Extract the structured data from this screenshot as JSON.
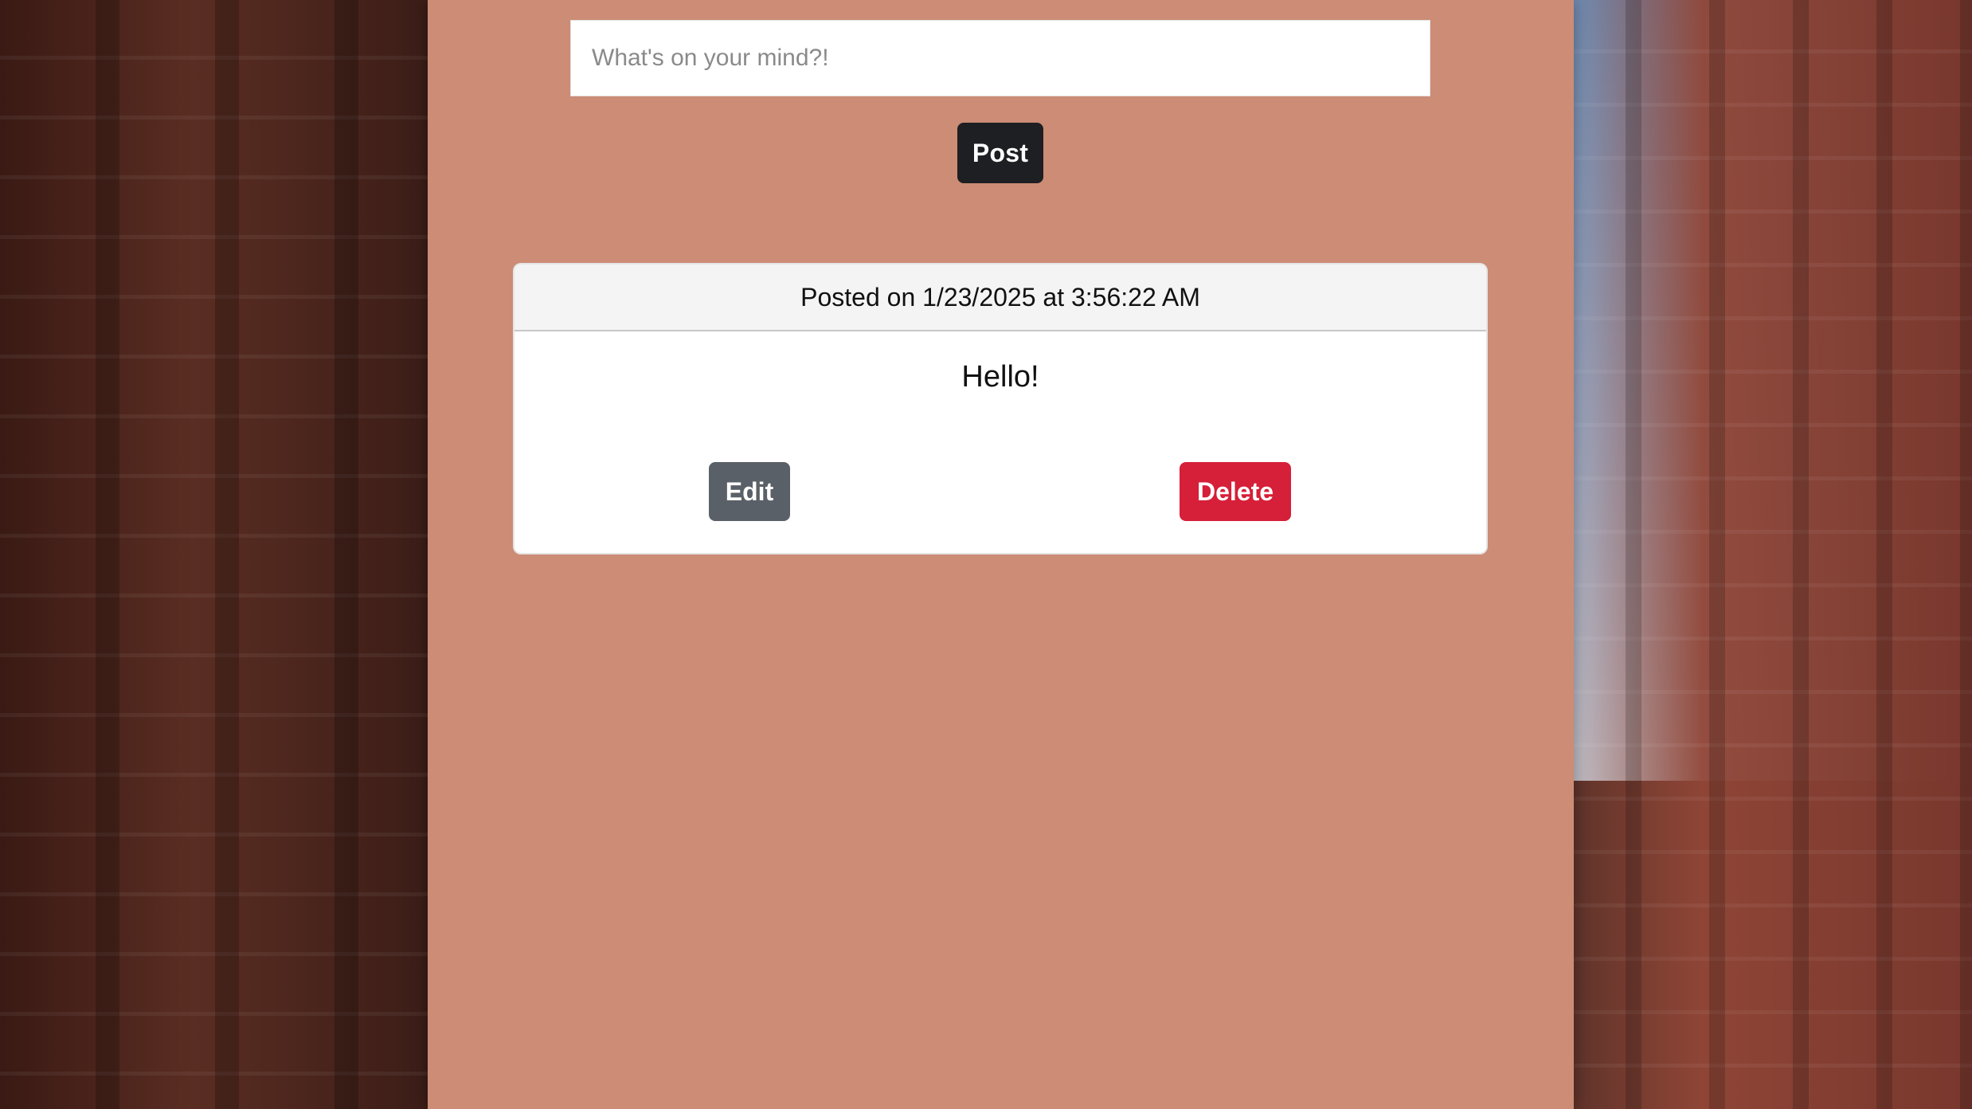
{
  "composer": {
    "placeholder": "What's on your mind?!"
  },
  "actions": {
    "post_label": "Post"
  },
  "posts": [
    {
      "header": "Posted on 1/23/2025 at 3:56:22 AM",
      "content": "Hello!",
      "edit_label": "Edit",
      "delete_label": "Delete"
    }
  ],
  "colors": {
    "panel": "#cc8c75",
    "post_button": "#1d1f22",
    "edit_button": "#5a6067",
    "delete_button": "#d61f38"
  }
}
